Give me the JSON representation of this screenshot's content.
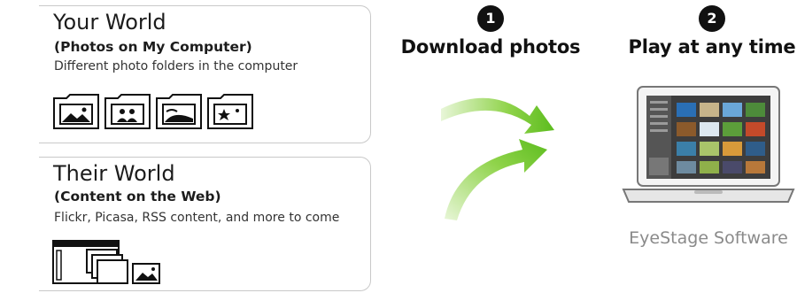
{
  "your_world": {
    "title": "Your World",
    "subtitle": "(Photos on My Computer)",
    "description": "Different photo folders in the computer",
    "icons": [
      "landscape-folder-icon",
      "people-folder-icon",
      "nature-folder-icon",
      "star-folder-icon"
    ]
  },
  "their_world": {
    "title": "Their World",
    "subtitle": "(Content on the Web)",
    "description": "Flickr, Picasa, RSS content, and more to come",
    "icons": [
      "web-window-photos-icon"
    ]
  },
  "steps": [
    {
      "number": "1",
      "label": "Download photos"
    },
    {
      "number": "2",
      "label": "Play at any time"
    }
  ],
  "product": {
    "caption": "EyeStage Software",
    "icon": "laptop-icon"
  },
  "colors": {
    "arrow_green": "#6ec52a",
    "arrow_light": "#e3f4cf",
    "panel_border": "#c9c9c9",
    "caption_gray": "#8a8a8a"
  }
}
